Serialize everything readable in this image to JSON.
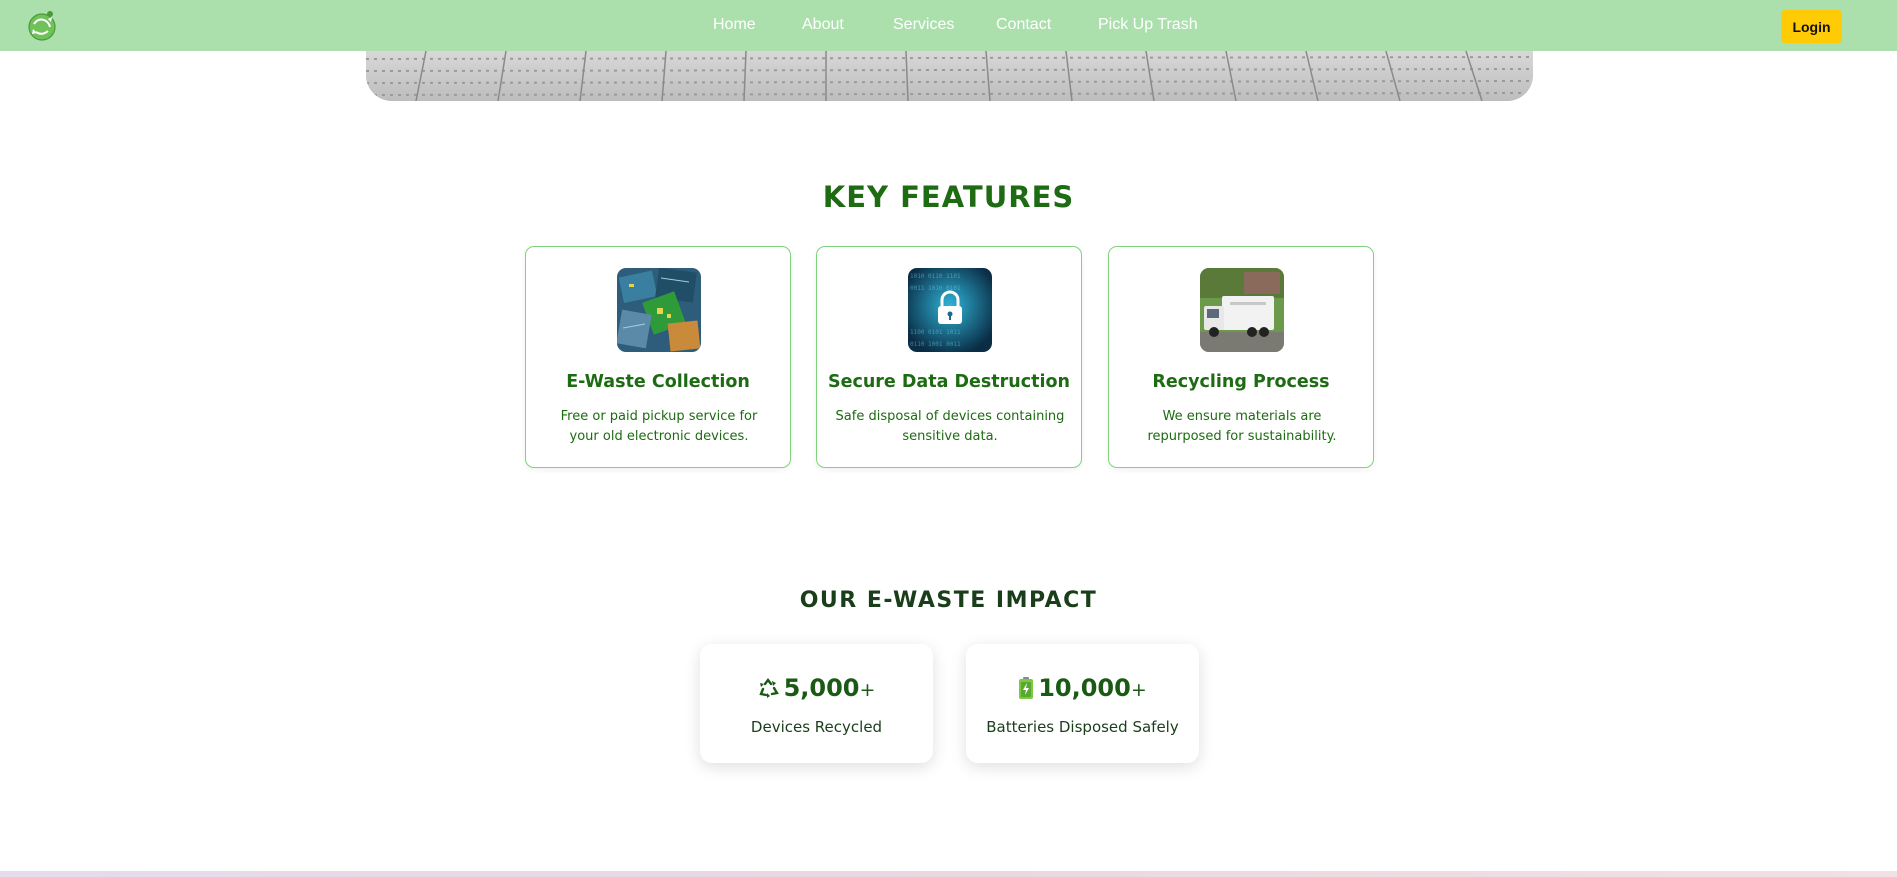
{
  "nav": {
    "links": [
      "Home",
      "About",
      "Services",
      "Contact",
      "Pick Up Trash"
    ],
    "login_label": "Login",
    "logo_icon": "recycle-globe-icon"
  },
  "features": {
    "title": "KEY FEATURES",
    "cards": [
      {
        "title": "E-Waste Collection",
        "description": "Free or paid pickup service for your old electronic devices.",
        "image": "circuit-boards-image"
      },
      {
        "title": "Secure Data Destruction",
        "description": "Safe disposal of devices containing sensitive data.",
        "image": "digital-lock-image"
      },
      {
        "title": "Recycling Process",
        "description": "We ensure materials are repurposed for sustainability.",
        "image": "recycling-truck-image"
      }
    ]
  },
  "impact": {
    "title": "OUR E-WASTE IMPACT",
    "stats": [
      {
        "icon": "recycle-icon",
        "number": "5,000",
        "suffix": "+",
        "label": "Devices Recycled"
      },
      {
        "icon": "battery-icon",
        "number": "10,000",
        "suffix": "+",
        "label": "Batteries Disposed Safely"
      }
    ]
  },
  "colors": {
    "navbar": "#abe0ac",
    "accent_green": "#1d6b12",
    "login_button": "#ffcb05",
    "card_border": "#7fd37d"
  }
}
